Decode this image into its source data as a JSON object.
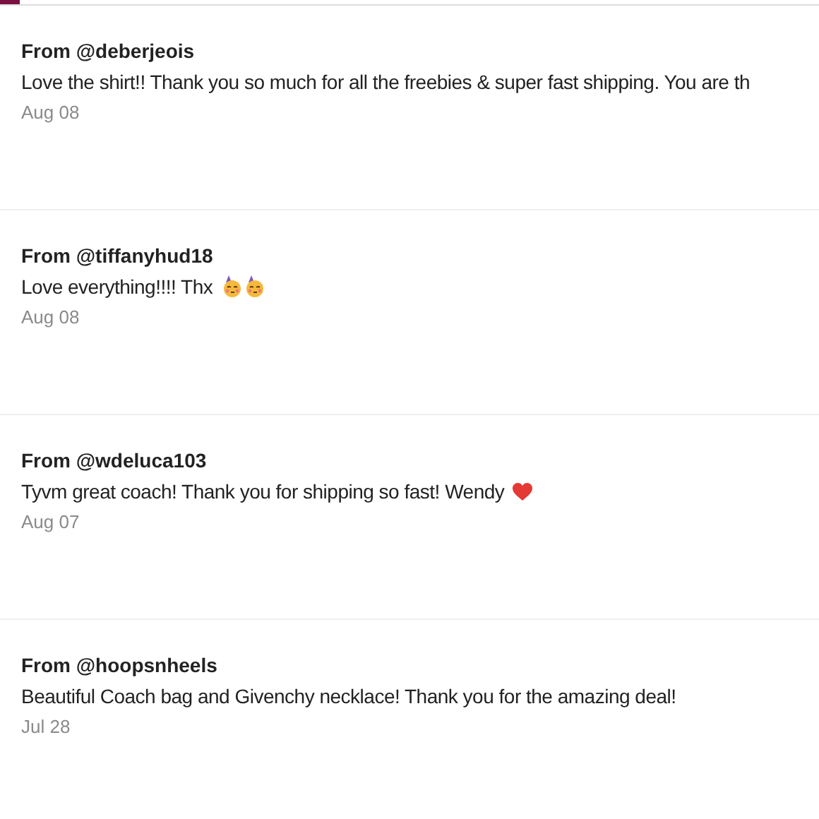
{
  "tabs_indicator": {
    "selected": true
  },
  "reviews": [
    {
      "from": "From @deberjeois",
      "text": "Love the shirt!! Thank you so much for all the freebies & super fast shipping. You are th",
      "date": "Aug 08"
    },
    {
      "from": "From @tiffanyhud18",
      "text": "Love everything!!!! Thx",
      "icons": [
        {
          "kind": "party-face"
        },
        {
          "kind": "party-face"
        }
      ],
      "date": "Aug 08"
    },
    {
      "from": "From @wdeluca103",
      "text": "Tyvm great coach! Thank you for shipping so fast! Wendy",
      "icons": [
        {
          "kind": "heart"
        }
      ],
      "date": "Aug 07"
    },
    {
      "from": "From @hoopsnheels",
      "text": "Beautiful Coach bag and Givenchy necklace! Thank you for the amazing deal!",
      "date": "Jul 28"
    }
  ]
}
